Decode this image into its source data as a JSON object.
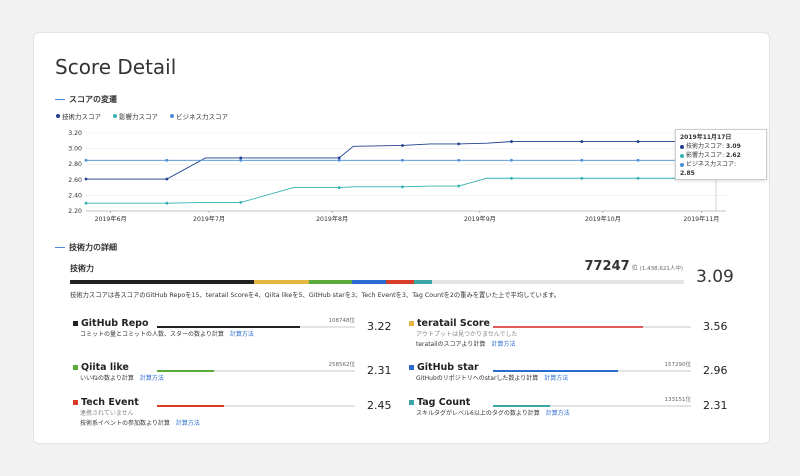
{
  "page": {
    "title": "Score Detail"
  },
  "sections": {
    "transition": "スコアの変遷",
    "detail": "技術力の詳細"
  },
  "legend": [
    {
      "label": "技術力スコア",
      "color": "#1f3f8f"
    },
    {
      "label": "影響力スコア",
      "color": "#35b0b3"
    },
    {
      "label": "ビジネス力スコア",
      "color": "#4a8fd6"
    }
  ],
  "chart_data": {
    "type": "line",
    "yticks": [
      "2.20",
      "2.40",
      "2.60",
      "2.80",
      "3.00",
      "3.20"
    ],
    "ylim": [
      2.2,
      3.2
    ],
    "xticks": [
      "2019年6月",
      "2019年7月",
      "2019年8月",
      "2019年9月",
      "2019年10月",
      "2019年11月"
    ],
    "x": [
      "2019-06-01",
      "2019-06-08",
      "2019-06-15",
      "2019-06-22",
      "2019-06-29",
      "2019-07-06",
      "2019-07-13",
      "2019-07-20",
      "2019-07-27",
      "2019-08-03",
      "2019-08-10",
      "2019-08-17",
      "2019-08-24",
      "2019-08-31",
      "2019-09-07",
      "2019-09-14",
      "2019-09-21",
      "2019-09-28",
      "2019-10-05",
      "2019-10-12",
      "2019-10-19",
      "2019-10-26",
      "2019-11-02",
      "2019-11-09",
      "2019-11-17"
    ],
    "series": [
      {
        "name": "技術力スコア",
        "color": "#1f3f8f",
        "values": [
          2.61,
          2.61,
          2.61,
          2.88,
          2.88,
          2.88,
          2.88,
          3.03,
          3.04,
          3.06,
          3.06,
          3.07,
          3.09,
          3.09,
          3.09,
          3.09,
          3.09,
          3.09,
          3.09,
          3.09,
          3.09,
          3.09,
          3.09,
          3.09,
          3.09
        ],
        "points": [
          0,
          5,
          8,
          16,
          17,
          24,
          25,
          28,
          37,
          42,
          50,
          57,
          64,
          70,
          80
        ]
      },
      {
        "name": "影響力スコア",
        "color": "#35b0b3",
        "values": [
          2.3,
          2.3,
          2.3,
          2.31,
          2.31,
          2.5,
          2.5,
          2.51,
          2.51,
          2.52,
          2.52,
          2.62,
          2.62,
          2.62,
          2.62,
          2.62,
          2.62,
          2.62,
          2.62,
          2.62,
          2.62,
          2.62,
          2.62,
          2.62,
          2.62
        ]
      },
      {
        "name": "ビジネス力スコア",
        "color": "#4a8fd6",
        "values": [
          2.85,
          2.85,
          2.85,
          2.85,
          2.85,
          2.85,
          2.85,
          2.85,
          2.85,
          2.85,
          2.85,
          2.85,
          2.85,
          2.85,
          2.85,
          2.85,
          2.85,
          2.85,
          2.85,
          2.85,
          2.85,
          2.85,
          2.85,
          2.85,
          2.85
        ]
      }
    ]
  },
  "tooltip": {
    "date": "2019年11月17日",
    "rows": [
      {
        "label": "技術力スコア:",
        "value": "3.09",
        "color": "#1f3f8f"
      },
      {
        "label": "影響力スコア:",
        "value": "2.62",
        "color": "#35b0b3"
      },
      {
        "label": "ビジネス力スコア:",
        "value": "2.85",
        "color": "#4a8fd6"
      }
    ]
  },
  "overall": {
    "label": "技術力",
    "rank": "77247",
    "rank_unit": "位",
    "rank_total": "(1,438,621人中)",
    "score": "3.09",
    "description": "技術力スコアは各スコアのGitHub Repoを15、teratail Scoreを4、Qiita likeを5、GitHub starを3、Tech Eventを3、Tag Countを2の重みを置いた上で平均しています。",
    "segments": [
      {
        "color": "#222222",
        "fraction": 0.3
      },
      {
        "color": "#e2b63f",
        "fraction": 0.09
      },
      {
        "color": "#5aab3a",
        "fraction": 0.07
      },
      {
        "color": "#2a6bd1",
        "fraction": 0.055
      },
      {
        "color": "#d93d27",
        "fraction": 0.045
      },
      {
        "color": "#3aa6a4",
        "fraction": 0.03
      }
    ]
  },
  "metrics": [
    {
      "name": "GitHub Repo",
      "color": "#222222",
      "rank": "108748位",
      "score": "3.22",
      "fill": 0.72,
      "note": "",
      "desc": "コミットの量とコミットの人数、スターの数より計算",
      "link": "計算方法"
    },
    {
      "name": "teratail Score",
      "color": "#e2b63f",
      "rank": "",
      "score": "3.56",
      "fill": 0.76,
      "bar_color": "#e05a5a",
      "note": "アウトプットは見つかりませんでした",
      "desc": "teratailのスコアより計算",
      "link": "計算方法"
    },
    {
      "name": "Qiita like",
      "color": "#5aab3a",
      "rank": "258562位",
      "score": "2.31",
      "fill": 0.29,
      "note": "",
      "desc": "いいねの数より計算",
      "link": "計算方法"
    },
    {
      "name": "GitHub star",
      "color": "#2a6bd1",
      "rank": "157290位",
      "score": "2.96",
      "fill": 0.63,
      "note": "",
      "desc": "GitHubのリポジトリへのstarした数より計算",
      "link": "計算方法"
    },
    {
      "name": "Tech Event",
      "color": "#d93d27",
      "rank": "",
      "score": "2.45",
      "fill": 0.34,
      "note": "連携されていません",
      "desc": "技術系イベントの参加数より計算",
      "link": "計算方法"
    },
    {
      "name": "Tag Count",
      "color": "#3aa6a4",
      "rank": "133151位",
      "score": "2.31",
      "fill": 0.29,
      "note": "",
      "desc": "スキルタグがレベル6以上のタグの数より計算",
      "link": "計算方法"
    }
  ]
}
